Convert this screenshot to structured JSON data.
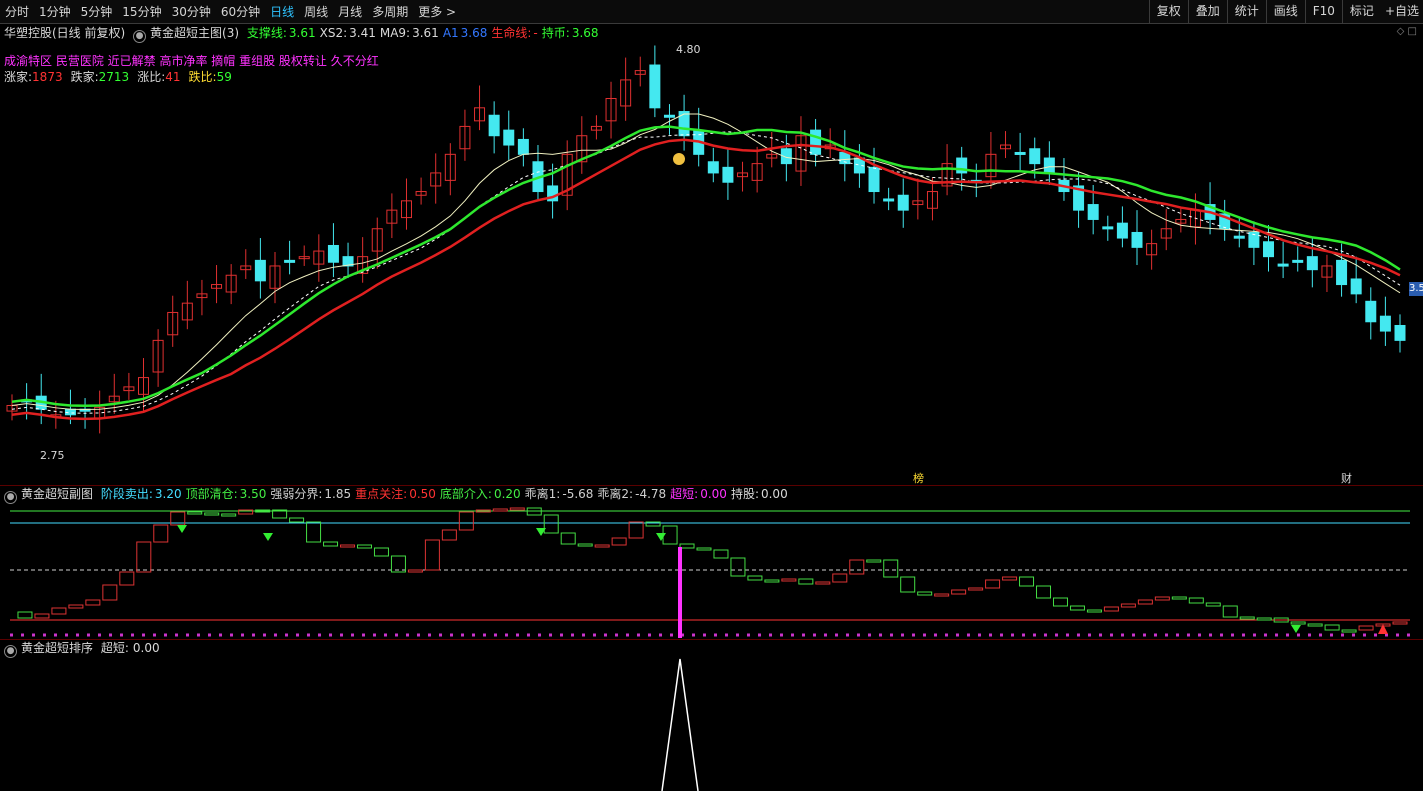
{
  "toolbar": {
    "periods": [
      "分时",
      "1分钟",
      "5分钟",
      "15分钟",
      "30分钟",
      "60分钟",
      "日线",
      "周线",
      "月线",
      "多周期",
      "更多 >"
    ],
    "active_period": "日线",
    "buttons": [
      "复权",
      "叠加",
      "统计",
      "画线",
      "F10",
      "标记",
      "+自选"
    ]
  },
  "main_panel": {
    "stock_title": "华塑控股(日线 前复权)",
    "indicator_name": "黄金超短主图(3)",
    "legend": [
      {
        "label": "支撑线:",
        "value": "3.61",
        "color": "#33ff33"
      },
      {
        "label": "XS2:",
        "value": "3.41",
        "color": "#d9d9d9"
      },
      {
        "label": "MA9:",
        "value": "3.61",
        "color": "#d9d9d9"
      },
      {
        "label": "A1",
        "value": "3.68",
        "color": "#3377ff"
      },
      {
        "label": "生命线:",
        "value": "-",
        "color": "#ff3333"
      },
      {
        "label": "持币:",
        "value": "3.68",
        "color": "#33ff33"
      }
    ],
    "tags": "成渝特区 民营医院 近已解禁 高市净率 摘帽 重组股 股权转让 久不分红",
    "stats": [
      {
        "label": "涨家:",
        "value": "1873",
        "label_color": "#d9d9d9",
        "value_color": "#ff3333"
      },
      {
        "label": "跌家:",
        "value": "2713",
        "label_color": "#d9d9d9",
        "value_color": "#33ff33"
      },
      {
        "label": "涨比:",
        "value": "41",
        "label_color": "#d9d9d9",
        "value_color": "#ff3333"
      },
      {
        "label": "跌比:",
        "value": "59",
        "label_color": "#ffdd33",
        "value_color": "#33ff33"
      }
    ],
    "high_label": "4.80",
    "low_label": "2.75",
    "marker_bang": "榜",
    "marker_cai": "财",
    "price_tag": "3.5"
  },
  "sub_panel": {
    "name": "黄金超短副图",
    "legend": [
      {
        "label": "阶段卖出:",
        "value": "3.20",
        "color": "#44ddff"
      },
      {
        "label": "顶部清仓:",
        "value": "3.50",
        "color": "#44ee44"
      },
      {
        "label": "强弱分界:",
        "value": "1.85",
        "color": "#cfcfcf"
      },
      {
        "label": "重点关注:",
        "value": "0.50",
        "color": "#ff3333"
      },
      {
        "label": "底部介入:",
        "value": "0.20",
        "color": "#44ee44"
      },
      {
        "label": "乖离1:",
        "value": "-5.68",
        "color": "#cfcfcf"
      },
      {
        "label": "乖离2:",
        "value": "-4.78",
        "color": "#cfcfcf"
      },
      {
        "label": "超短:",
        "value": "0.00",
        "color": "#ff33ff"
      },
      {
        "label": "持股:",
        "value": "0.00",
        "color": "#d9d9d9"
      }
    ]
  },
  "rank_panel": {
    "name": "黄金超短排序",
    "legend_label": "超短:",
    "legend_value": "0.00"
  },
  "colors": {
    "up": "#e03030",
    "down": "#44e8f0",
    "support": "#2ee82e",
    "life": "#e02020",
    "ma": "#f0f0c0"
  }
}
